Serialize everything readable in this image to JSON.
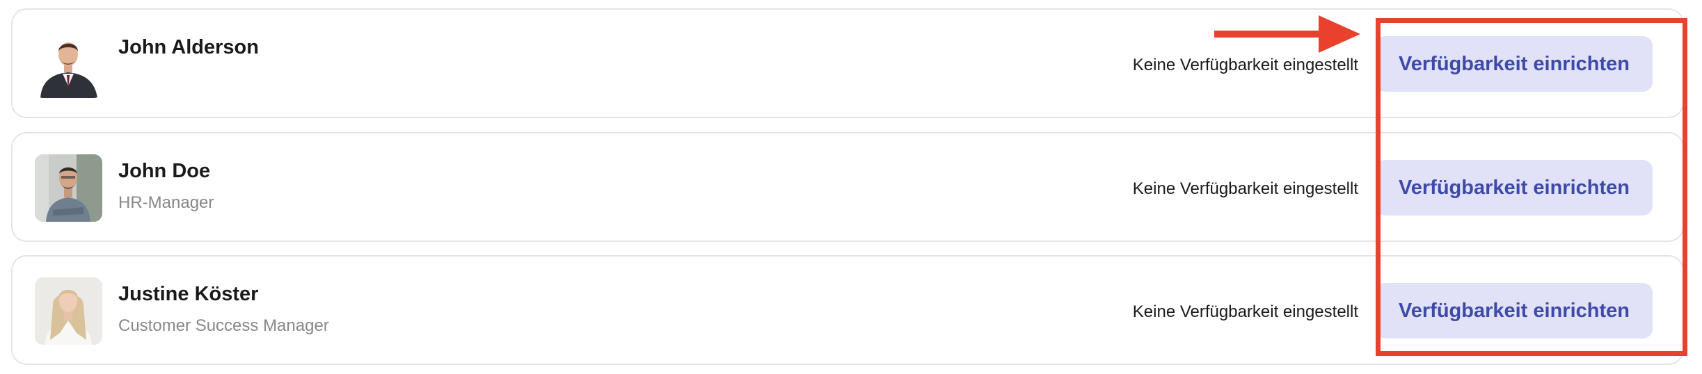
{
  "colors": {
    "button_bg": "#e1e2f7",
    "button_text": "#3e4aa8",
    "annotation": "#e8412e",
    "card_border": "#e4e4e4"
  },
  "employees": [
    {
      "name": "John Alderson",
      "role": "",
      "status": "Keine Verfügbarkeit eingestellt",
      "button_label": "Verfügbarkeit einrichten"
    },
    {
      "name": "John Doe",
      "role": "HR-Manager",
      "status": "Keine Verfügbarkeit eingestellt",
      "button_label": "Verfügbarkeit einrichten"
    },
    {
      "name": "Justine Köster",
      "role": "Customer Success Manager",
      "status": "Keine Verfügbarkeit eingestellt",
      "button_label": "Verfügbarkeit einrichten"
    }
  ],
  "annotation": {
    "arrow_icon": "arrow-right-icon",
    "box": "highlight-box"
  }
}
